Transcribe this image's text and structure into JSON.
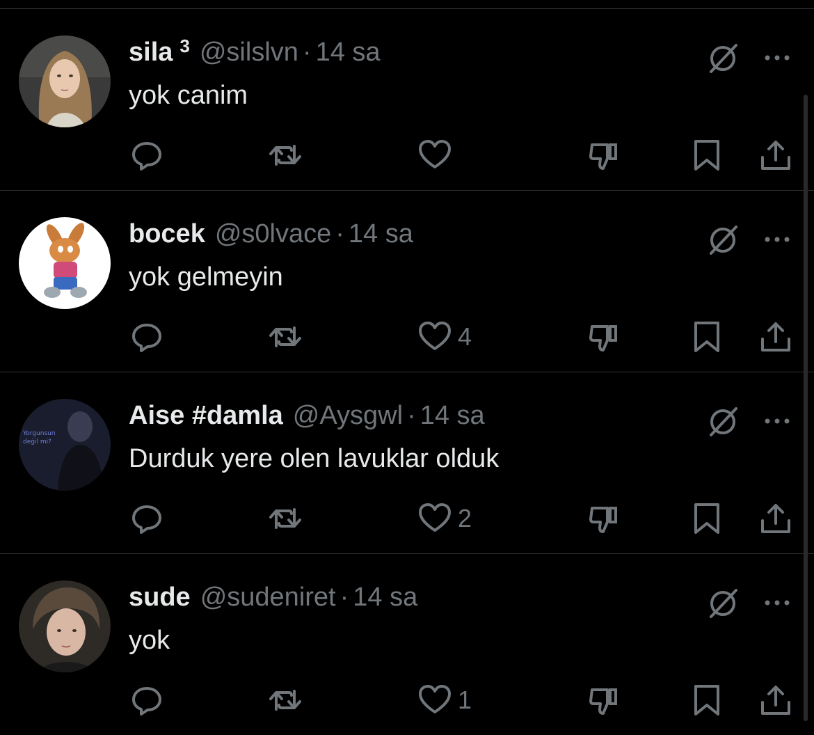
{
  "colors": {
    "background": "#000000",
    "text_primary": "#e7e9ea",
    "text_secondary": "#71767b",
    "divider": "#2f3336"
  },
  "tweets": [
    {
      "name": "sila",
      "badge": "3",
      "handle": "@silslvn",
      "separator": "·",
      "time": "14 sa",
      "text": "yok canim",
      "like_count": "",
      "avatar_icon": "avatar-woman-photo"
    },
    {
      "name": "bocek",
      "badge": "",
      "handle": "@s0lvace",
      "separator": "·",
      "time": "14 sa",
      "text": "yok gelmeyin",
      "like_count": "4",
      "avatar_icon": "avatar-cartoon-rabbit"
    },
    {
      "name": "Aise #damla",
      "badge": "",
      "handle": "@Aysgwl",
      "separator": "·",
      "time": "14 sa",
      "text": "Durduk yere olen lavuklar olduk",
      "like_count": "2",
      "avatar_icon": "avatar-dark-portrait",
      "avatar_text": [
        "Yorgunsun",
        "değil mi?"
      ]
    },
    {
      "name": "sude",
      "badge": "",
      "handle": "@sudeniret",
      "separator": "·",
      "time": "14 sa",
      "text": "yok",
      "like_count": "1",
      "avatar_icon": "avatar-boy-photo"
    }
  ],
  "icons": {
    "reply": "reply-icon",
    "retweet": "retweet-icon",
    "like": "heart-icon",
    "dislike": "thumbs-down-icon",
    "bookmark": "bookmark-icon",
    "share": "share-icon",
    "grok": "grok-icon",
    "more": "more-icon"
  }
}
